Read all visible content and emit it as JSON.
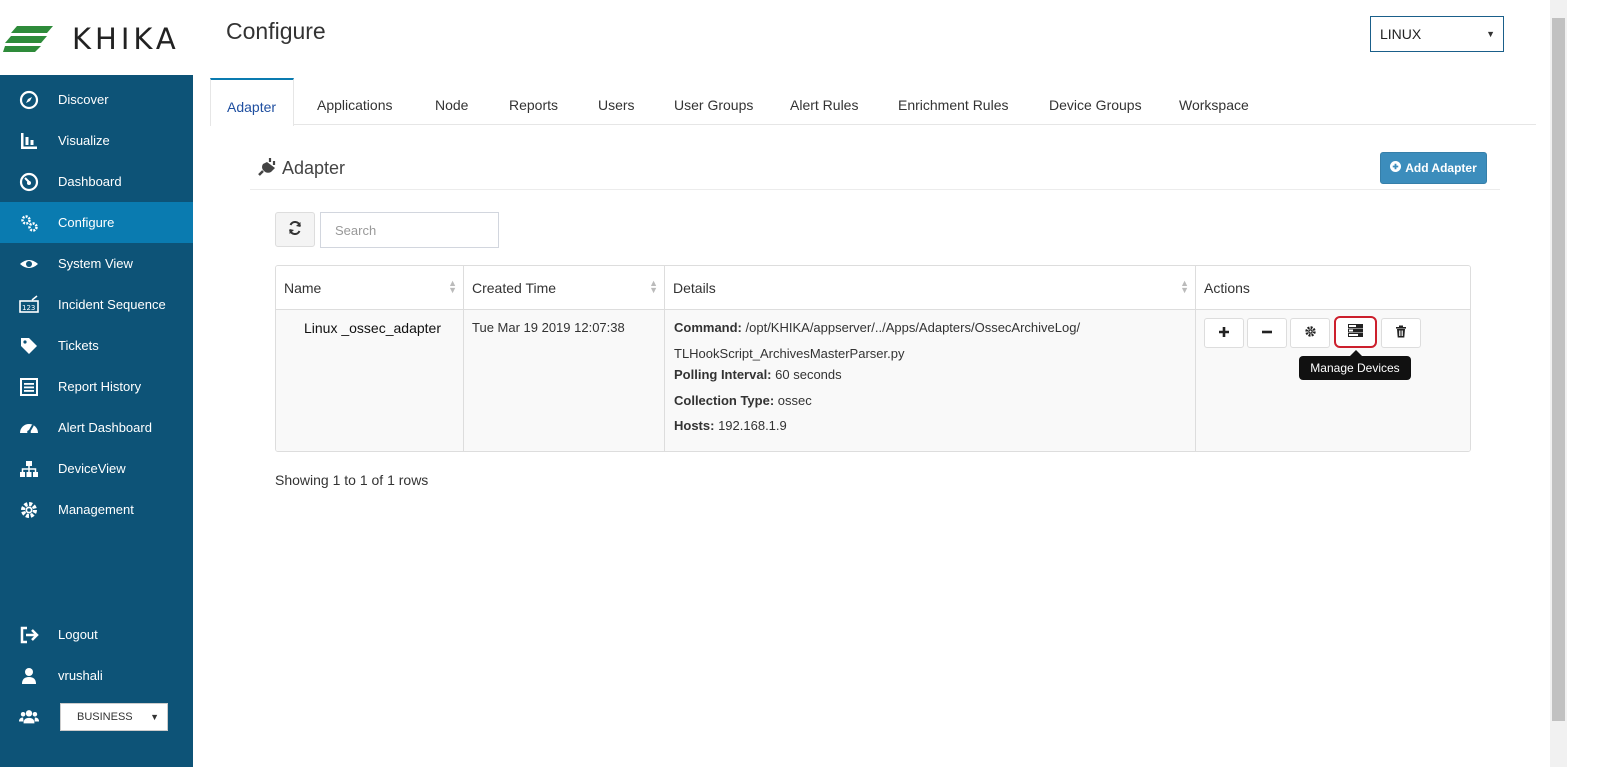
{
  "brand": {
    "logo_text": "KHIKA"
  },
  "page": {
    "title": "Configure"
  },
  "header": {
    "os_select_value": "LINUX"
  },
  "sidebar": {
    "items": [
      {
        "label": "Discover",
        "icon": "compass-icon"
      },
      {
        "label": "Visualize",
        "icon": "bar-chart-icon"
      },
      {
        "label": "Dashboard",
        "icon": "dashboard-icon"
      },
      {
        "label": "Configure",
        "icon": "cogs-icon",
        "active": true
      },
      {
        "label": "System View",
        "icon": "eye-icon"
      },
      {
        "label": "Incident Sequence",
        "icon": "sequence-icon"
      },
      {
        "label": "Tickets",
        "icon": "tag-icon"
      },
      {
        "label": "Report History",
        "icon": "list-alt-icon"
      },
      {
        "label": "Alert Dashboard",
        "icon": "gauge-icon"
      },
      {
        "label": "DeviceView",
        "icon": "sitemap-icon"
      },
      {
        "label": "Management",
        "icon": "gear-icon"
      }
    ],
    "bottom": {
      "logout": "Logout",
      "user": "vrushali",
      "business_select": "BUSINESS"
    }
  },
  "tabs": [
    {
      "label": "Adapter",
      "active": true
    },
    {
      "label": "Applications"
    },
    {
      "label": "Node"
    },
    {
      "label": "Reports"
    },
    {
      "label": "Users"
    },
    {
      "label": "User Groups"
    },
    {
      "label": "Alert Rules"
    },
    {
      "label": "Enrichment Rules"
    },
    {
      "label": "Device Groups"
    },
    {
      "label": "Workspace"
    }
  ],
  "panel": {
    "title": "Adapter",
    "add_button": "Add Adapter"
  },
  "search": {
    "placeholder": "Search"
  },
  "table": {
    "columns": [
      "Name",
      "Created Time",
      "Details",
      "Actions"
    ],
    "rows": [
      {
        "name": "Linux _ossec_adapter",
        "created_time": "Tue Mar 19 2019 12:07:38",
        "details": {
          "command_label": "Command:",
          "command_value": "/opt/KHIKA/appserver/../Apps/Adapters/OssecArchiveLog/",
          "command_value_2": "TLHookScript_ArchivesMasterParser.py",
          "polling_label": "Polling Interval:",
          "polling_value": "60 seconds",
          "collection_label": "Collection Type:",
          "collection_value": "ossec",
          "hosts_label": "Hosts:",
          "hosts_value": "192.168.1.9"
        }
      }
    ]
  },
  "tooltip": "Manage Devices",
  "pagination": {
    "info": "Showing 1 to 1 of 1 rows"
  },
  "colors": {
    "sidebar_bg": "#0d5377",
    "sidebar_active": "#0a7bb0",
    "primary_button": "#3c8dbc",
    "highlight": "#cc1f2c"
  }
}
